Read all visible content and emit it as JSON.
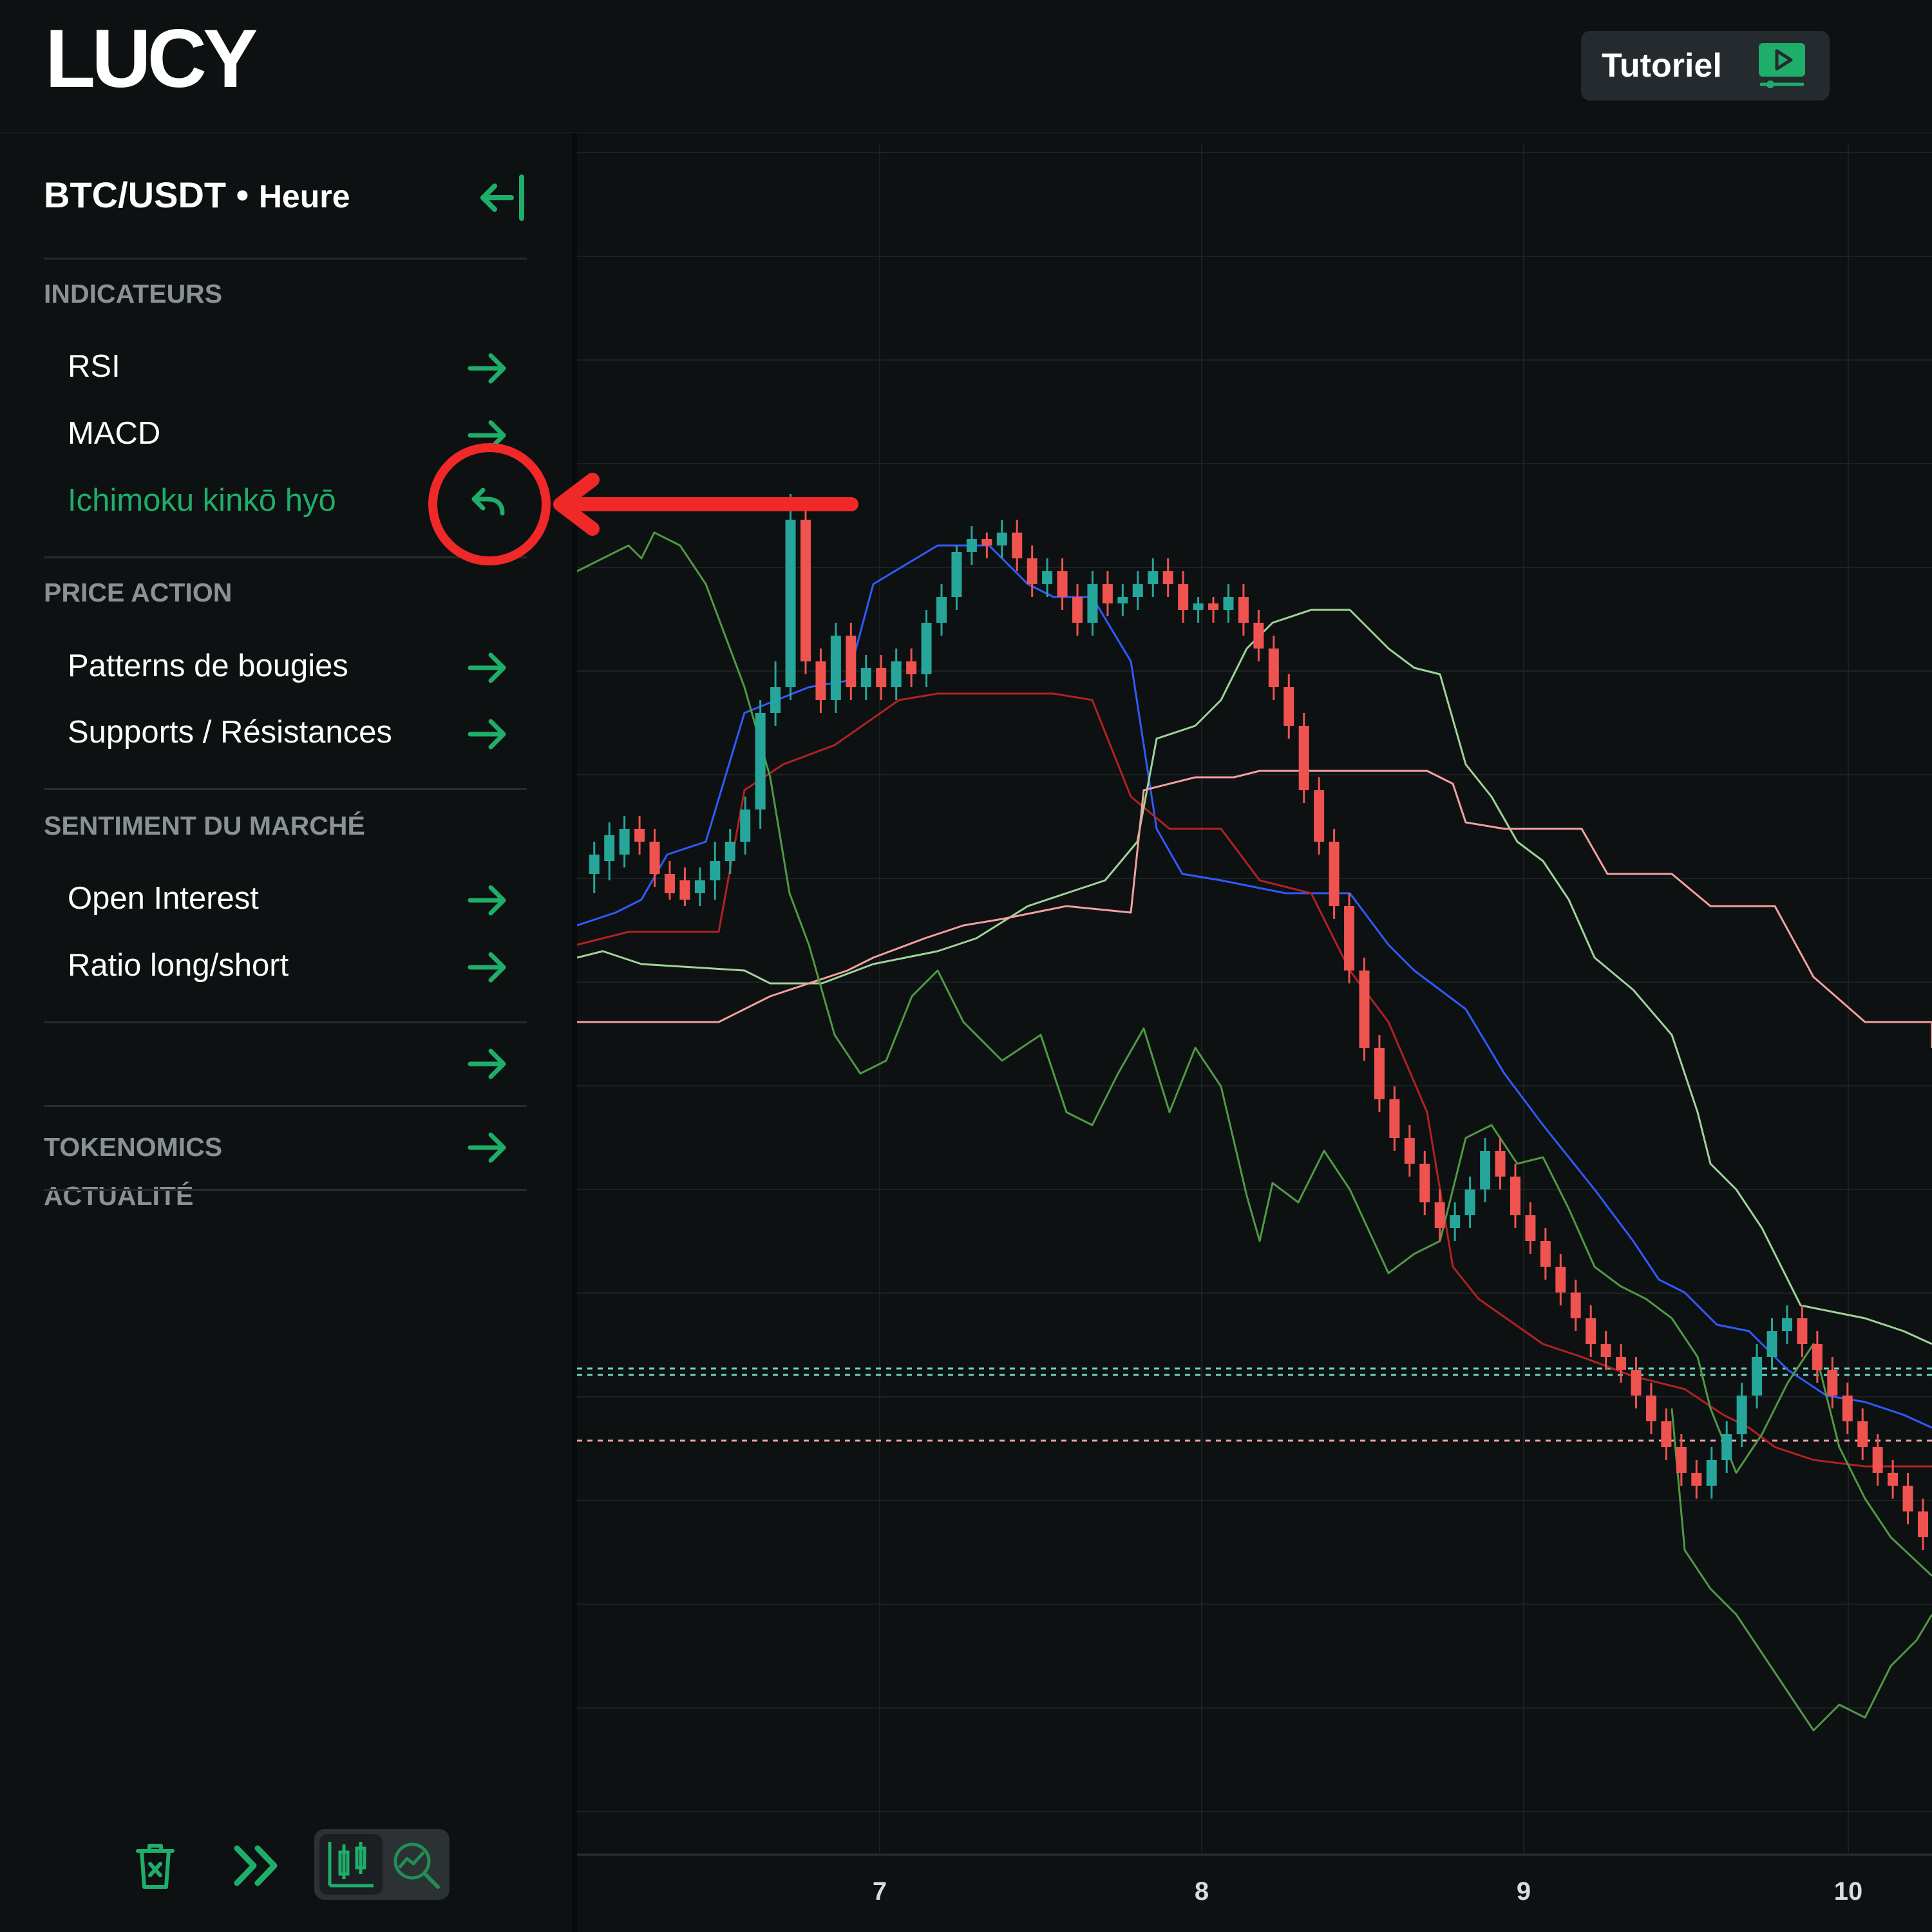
{
  "header": {
    "logo": "LUCY",
    "tutorial_button": "Tutoriel",
    "tutorial_icon": "video-play-icon"
  },
  "sidebar": {
    "pair": "BTC/USDT",
    "separator": "•",
    "timeframe": "Heure",
    "collapse_icon": "collapse-left-icon",
    "sections": {
      "indicators": {
        "title": "INDICATEURS",
        "items": [
          "RSI",
          "MACD",
          "Ichimoku kinkō hyō"
        ],
        "active_item": "Ichimoku kinkō hyō"
      },
      "price_action": {
        "title": "PRICE ACTION",
        "items": [
          "Patterns de bougies",
          "Supports / Résistances"
        ]
      },
      "sentiment": {
        "title": "SENTIMENT DU MARCHÉ",
        "items": [
          "Open Interest",
          "Ratio long/short"
        ]
      },
      "news": {
        "title": "ACTUALITÉ"
      },
      "tokenomics": {
        "title": "TOKENOMICS"
      }
    },
    "bottom_tools": [
      "trash-icon",
      "fast-forward-icon",
      "candlestick-icon",
      "chart-search-icon"
    ]
  },
  "colors": {
    "accent": "#1fae6a",
    "bull": "#26a69a",
    "bear": "#ef5350",
    "tenkan": "#2f5bff",
    "kijun": "#b22222",
    "span_a": "#9fd39a",
    "span_b": "#f4a0a0",
    "chikou": "#4f9a45",
    "annotation": "#f02828"
  },
  "chart_data": {
    "type": "candlestick",
    "title": "",
    "x_ticks": [
      "7",
      "8",
      "9",
      "10"
    ],
    "indicator": "Ichimoku kinkō hyō",
    "series": [
      {
        "name": "candles"
      },
      {
        "name": "tenkan"
      },
      {
        "name": "kijun"
      },
      {
        "name": "senkou_span_a"
      },
      {
        "name": "senkou_span_b"
      },
      {
        "name": "chikou"
      }
    ],
    "grid": true
  }
}
